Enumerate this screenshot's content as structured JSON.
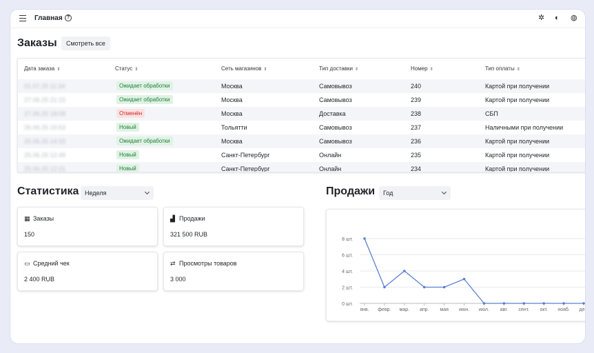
{
  "topbar": {
    "title": "Главная",
    "help_icon": "question-circle-icon",
    "right_icons": [
      "magic-wand-icon",
      "contrast-icon",
      "globe-icon"
    ]
  },
  "orders": {
    "title": "Заказы",
    "see_all_label": "Смотреть все",
    "columns": [
      "Дата заказа",
      "Статус",
      "Сеть магазинов",
      "Тип доставки",
      "Номер",
      "Тип оплаты"
    ],
    "rows": [
      {
        "date": "01.07.25 11:34",
        "status": "Ожидает обработки",
        "status_color": "green",
        "store": "Москва",
        "delivery": "Самовывоз",
        "number": "240",
        "payment": "Картой при получении"
      },
      {
        "date": "27.06.25 21:15",
        "status": "Ожидает обработки",
        "status_color": "green",
        "store": "Москва",
        "delivery": "Самовывоз",
        "number": "239",
        "payment": "Картой при получении"
      },
      {
        "date": "27.06.25 18:08",
        "status": "Отменён",
        "status_color": "red",
        "store": "Москва",
        "delivery": "Доставка",
        "number": "238",
        "payment": "СБП"
      },
      {
        "date": "26.06.25 15:53",
        "status": "Новый",
        "status_color": "green",
        "store": "Тольятти",
        "delivery": "Самовывоз",
        "number": "237",
        "payment": "Наличными при получении"
      },
      {
        "date": "25.06.25 14:33",
        "status": "Ожидает обработки",
        "status_color": "green",
        "store": "Москва",
        "delivery": "Самовывоз",
        "number": "236",
        "payment": "Картой при получении"
      },
      {
        "date": "25.06.25 12:49",
        "status": "Новый",
        "status_color": "green",
        "store": "Санкт-Петербург",
        "delivery": "Онлайн",
        "number": "235",
        "payment": "Картой при получении"
      },
      {
        "date": "25.06.25 12:21",
        "status": "Новый",
        "status_color": "green",
        "store": "Санкт-Петербург",
        "delivery": "Онлайн",
        "number": "234",
        "payment": "Картой при получении"
      }
    ]
  },
  "statistics": {
    "title": "Статистика",
    "period": "Неделя",
    "cards": [
      {
        "label": "Заказы",
        "value": "150",
        "icon": "orders-icon",
        "glyph": "▦"
      },
      {
        "label": "Продажи",
        "value": "321 500 RUB",
        "icon": "bar-chart-icon",
        "glyph": "▟"
      },
      {
        "label": "Средний чек",
        "value": "2 400 RUB",
        "icon": "cash-icon",
        "glyph": "▭"
      },
      {
        "label": "Просмотры товаров",
        "value": "3 000",
        "icon": "views-icon",
        "glyph": "⇄"
      }
    ]
  },
  "sales": {
    "title": "Продажи",
    "period": "Год"
  },
  "chart_data": {
    "type": "line",
    "categories": [
      "янв.",
      "февр.",
      "мар.",
      "апр.",
      "мая",
      "июн.",
      "июл.",
      "авг.",
      "сент.",
      "окт.",
      "нояб.",
      "дек."
    ],
    "values": [
      8,
      2,
      4,
      2,
      2,
      3,
      0,
      0,
      0,
      0,
      0,
      0
    ],
    "y_ticks": [
      "0 шт.",
      "2 шт.",
      "4 шт.",
      "6 шт.",
      "8 шт."
    ],
    "ylim": [
      0,
      8
    ],
    "grid": true,
    "color": "#5b7fd1"
  }
}
